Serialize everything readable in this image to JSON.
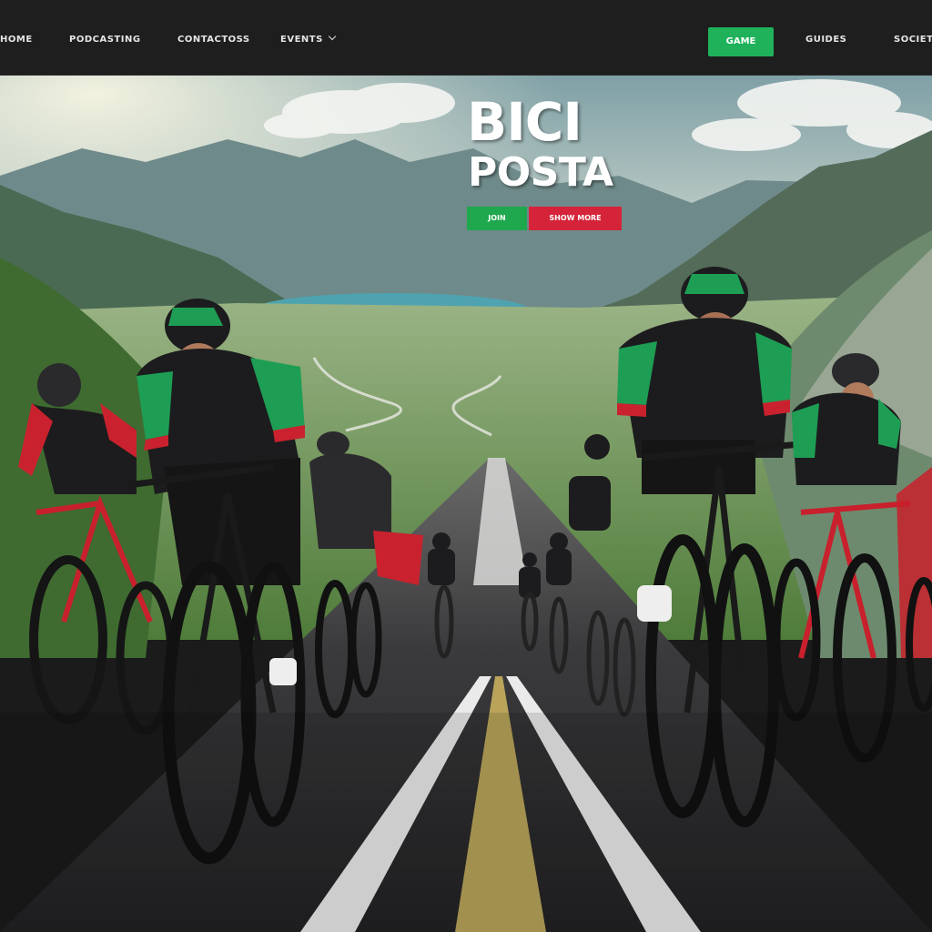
{
  "nav": {
    "items": [
      {
        "label": "HOME"
      },
      {
        "label": "PODCASTING"
      },
      {
        "label": "CONTACTOSS"
      },
      {
        "label": "EVENTS",
        "has_dropdown": true
      },
      {
        "label": "GUIDES"
      },
      {
        "label": "SOCIETY"
      }
    ],
    "cta_label": "GAME"
  },
  "hero": {
    "brand_line1": "BICI",
    "brand_line2": "POSTA",
    "button_primary": "JOIN",
    "button_secondary": "SHOW MORE"
  },
  "colors": {
    "nav_bg": "#1e1e1e",
    "accent_green": "#1fb25a",
    "accent_red": "#d5243a",
    "jersey_green": "#1e9e54",
    "jersey_black": "#1c1c1e",
    "bike_red": "#c8202c",
    "road": "#3a3a3c",
    "center_line": "#b9a45a"
  }
}
